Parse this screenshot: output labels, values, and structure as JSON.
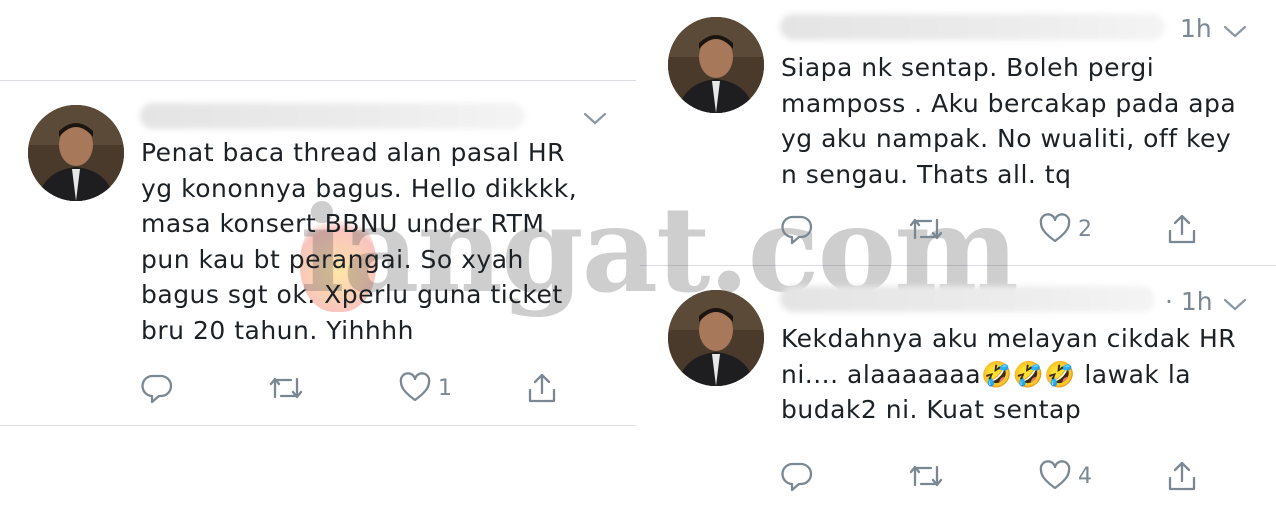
{
  "tweets": [
    {
      "text": "Penat baca thread alan pasal HR\nyg kononnya bagus. Hello dikkkk,\nmasa konsert BBNU under RTM\npun kau bt perangai. So xyah\nbagus sgt ok. Xperlu guna ticket\nbru 20 tahun. Yihhhh",
      "time": "",
      "likes": "1",
      "icons": [
        "reply-icon",
        "retweet-icon",
        "like-icon",
        "share-icon"
      ]
    },
    {
      "text": "Siapa nk sentap. Boleh pergi\nmamposs . Aku bercakap pada apa\nyg aku nampak. No wualiti, off key\nn sengau. Thats all. tq",
      "time": "1h",
      "likes": "2",
      "icons": [
        "reply-icon",
        "retweet-icon",
        "like-icon",
        "share-icon"
      ]
    },
    {
      "text": "Kekdahnya aku melayan cikdak HR\nni.... alaaaaaaa🤣🤣🤣 lawak la\nbudak2 ni. Kuat sentap",
      "time": "· 1h",
      "likes": "4",
      "icons": [
        "reply-icon",
        "retweet-icon",
        "like-icon",
        "share-icon"
      ]
    }
  ],
  "watermark": "iangat.com",
  "colors": {
    "icon": "#7a8893",
    "divider": "#d9dde1",
    "text": "#1c2126"
  }
}
